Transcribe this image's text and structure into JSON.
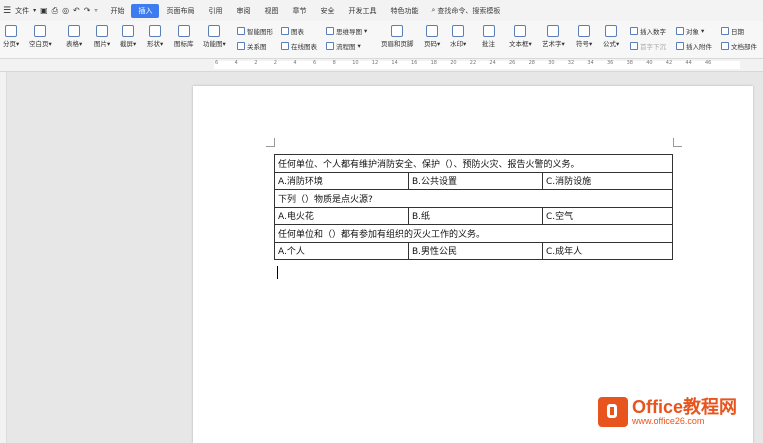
{
  "menubar": {
    "file_label": "文件",
    "tabs": [
      {
        "label": "开始"
      },
      {
        "label": "插入",
        "active": true
      },
      {
        "label": "页面布局"
      },
      {
        "label": "引用"
      },
      {
        "label": "审阅"
      },
      {
        "label": "视图"
      },
      {
        "label": "章节"
      },
      {
        "label": "安全"
      },
      {
        "label": "开发工具"
      },
      {
        "label": "特色功能"
      }
    ],
    "search_label": "查找命令、搜索模板"
  },
  "ribbon": {
    "page_break": "分页",
    "blank_page": "空白页",
    "table": "表格",
    "picture": "图片",
    "screenshot": "截屏",
    "shape": "形状",
    "icon_library": "图标库",
    "function_chart": "功能图",
    "smart_shape": "智能图形",
    "relation_chart": "关系图",
    "chart": "图表",
    "online_chart": "在线图表",
    "mind_map": "思维导图",
    "flow_chart": "流程图",
    "header_footer": "页眉和页脚",
    "page_number": "页码",
    "watermark": "水印",
    "comment": "批注",
    "textbox": "文本框",
    "wordart": "艺术字",
    "symbol": "符号",
    "formula": "公式",
    "first_letter_sink": "首字下沉",
    "insert_number": "插入数字",
    "object": "对象",
    "date": "日期",
    "insert_attachment": "插入附件",
    "doc_parts": "文档部件"
  },
  "ruler": {
    "ticks": [
      "6",
      "4",
      "2",
      "2",
      "4",
      "6",
      "8",
      "10",
      "12",
      "14",
      "16",
      "18",
      "20",
      "22",
      "24",
      "26",
      "28",
      "30",
      "32",
      "34",
      "36",
      "38",
      "40",
      "42",
      "44",
      "46"
    ]
  },
  "document": {
    "q1": "任何单位、个人都有维护消防安全、保护（）、预防火灾、报告火警的义务。",
    "q1_options": [
      "A.消防环境",
      "B.公共设置",
      "C.消防设施"
    ],
    "q2": "下列（）物质是点火源?",
    "q2_options": [
      "A.电火花",
      "B.纸",
      "C.空气"
    ],
    "q3": "任何单位和（）都有参加有组织的灭火工作的义务。",
    "q3_options": [
      "A.个人",
      "B.男性公民",
      "C.成年人"
    ]
  },
  "watermark": {
    "brand": "Office教程网",
    "url": "www.office26.com"
  }
}
